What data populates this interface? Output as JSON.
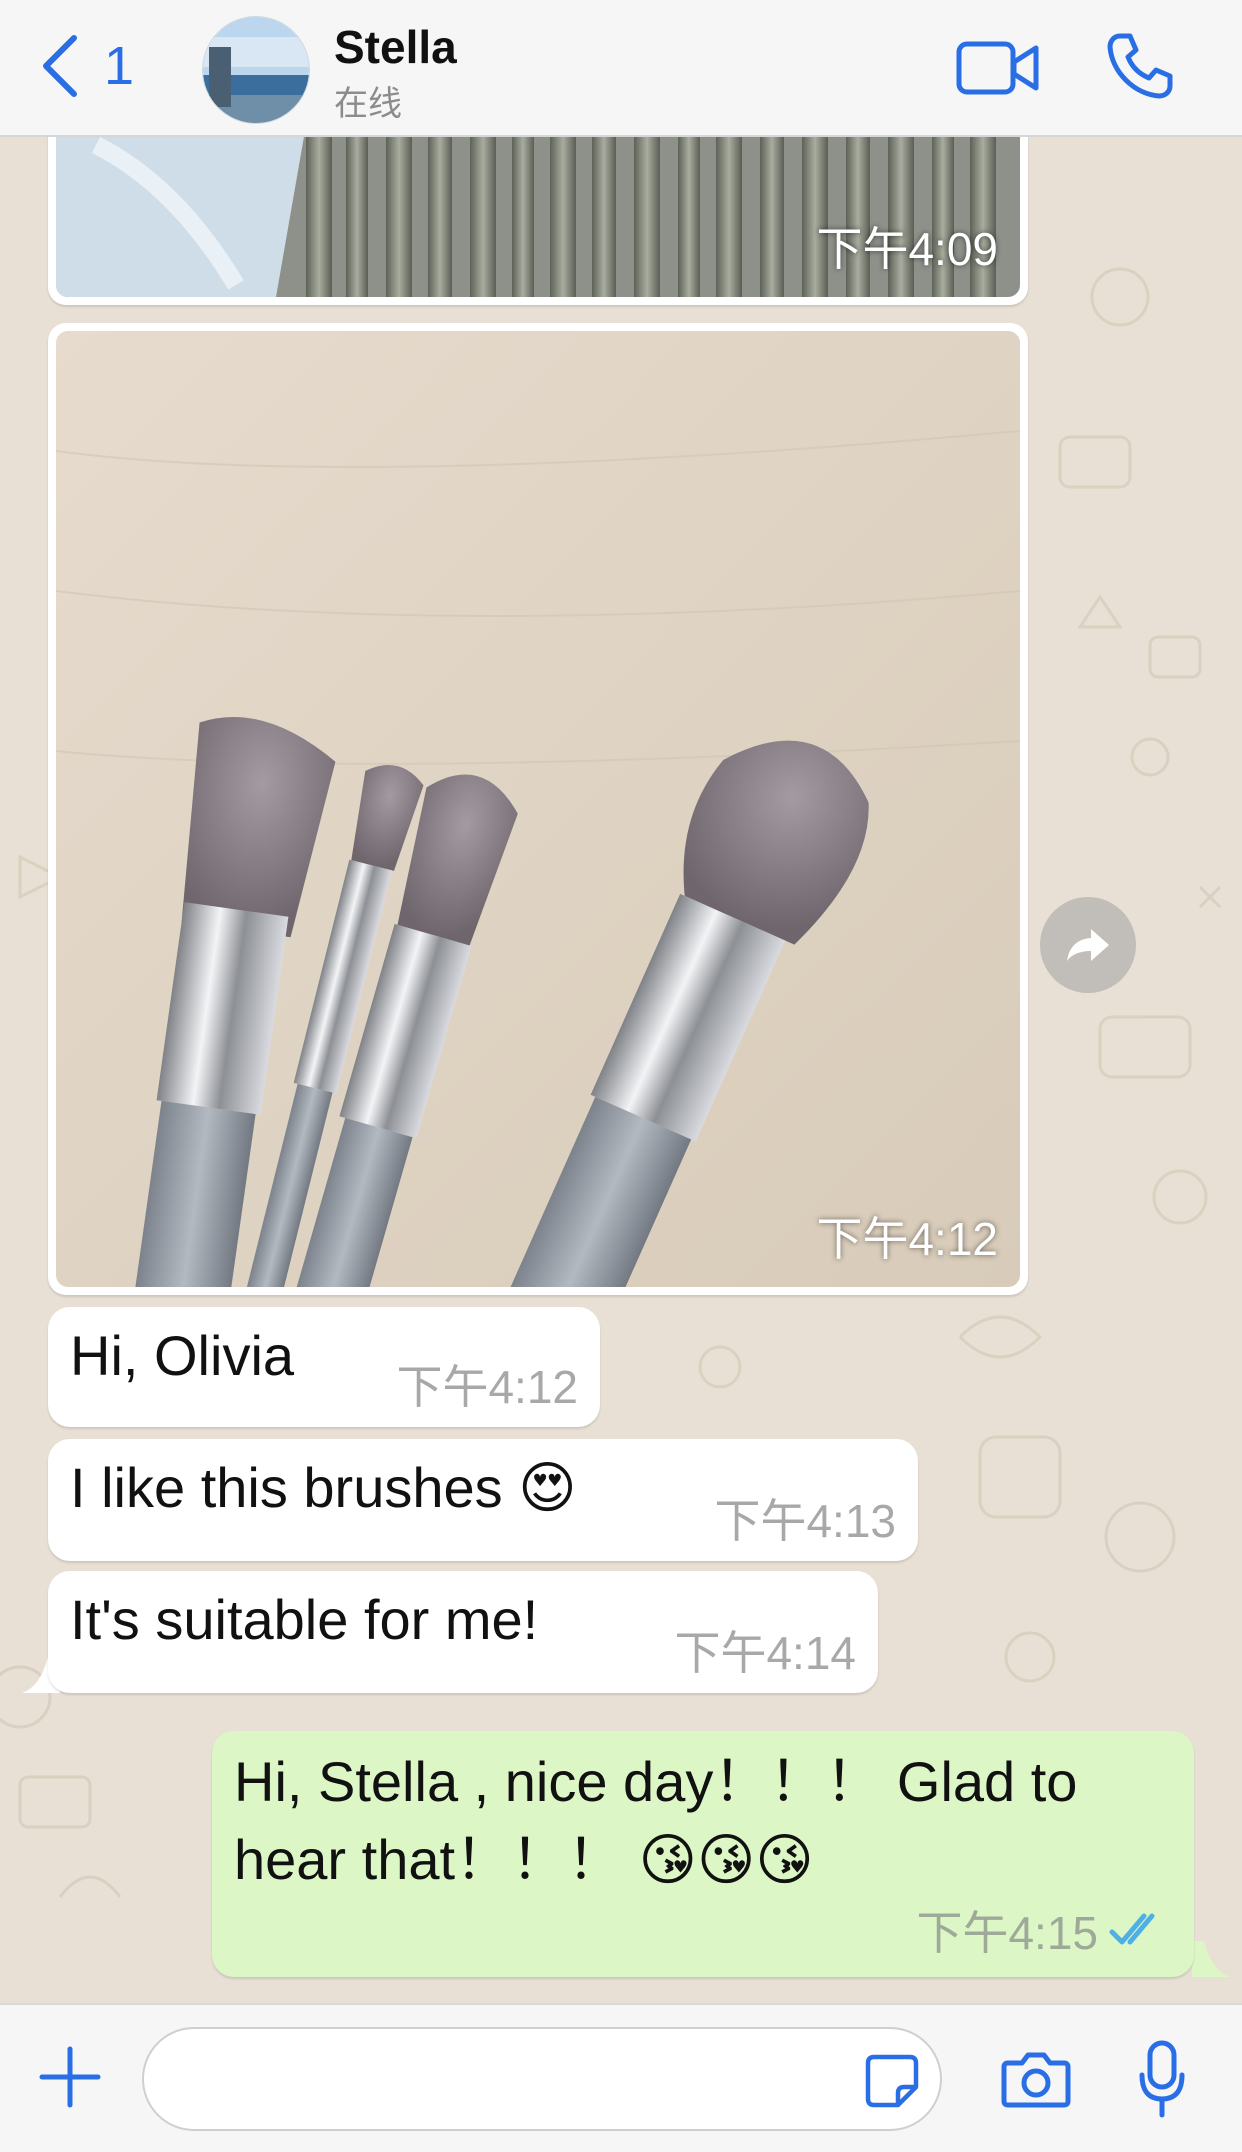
{
  "header": {
    "back_count": "1",
    "contact_name": "Stella",
    "status": "在线"
  },
  "messages": {
    "image1": {
      "time": "下午4:09"
    },
    "image2": {
      "time": "下午4:12"
    },
    "text1": {
      "text": "Hi, Olivia",
      "time": "下午4:12"
    },
    "text2": {
      "text": "I like this brushes 😍",
      "time": "下午4:13"
    },
    "text3": {
      "text": "It's suitable for me!",
      "time": "下午4:14"
    },
    "reply": {
      "text": "Hi, Stella , nice day！！！ Glad to hear that！！！ 😘😘😘",
      "time": "下午4:15"
    }
  },
  "composer": {
    "placeholder": ""
  },
  "colors": {
    "accent": "#2a6ee6",
    "outgoing": "#dcf7c5",
    "incoming": "#ffffff",
    "read_ticks": "#4fb0e6"
  }
}
